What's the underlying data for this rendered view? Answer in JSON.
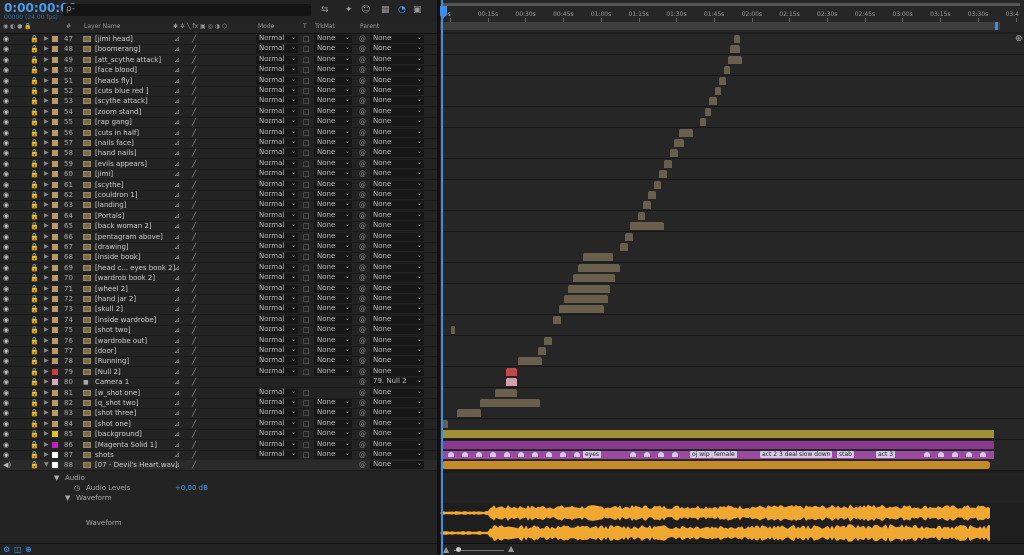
{
  "timecode": "0:00:00:00",
  "fps": "00000 (24.00 fps)",
  "search_placeholder": "ρ-",
  "columns": {
    "num": "#",
    "layer_name": "Layer Name",
    "mode": "Mode",
    "t": "T",
    "trkmat": "TrkMat",
    "parent": "Parent"
  },
  "ruler_labels": [
    "00s",
    "00:15s",
    "00:30s",
    "00:45s",
    "01:00s",
    "01:15s",
    "01:30s",
    "01:45s",
    "02:00s",
    "02:15s",
    "02:30s",
    "02:45s",
    "03:00s",
    "03:15s",
    "03:30s",
    "03:4"
  ],
  "layers": [
    {
      "num": "47",
      "name": "[jimi head]",
      "mode": "Normal",
      "trk": "None",
      "parent": "None",
      "color": "#b89968",
      "bar_start": 294,
      "bar_len": 6
    },
    {
      "num": "48",
      "name": "[boomerang]",
      "mode": "Normal",
      "trk": "None",
      "parent": "None",
      "color": "#b89968",
      "bar_start": 290,
      "bar_len": 10
    },
    {
      "num": "49",
      "name": "[att_scythe attack]",
      "mode": "Normal",
      "trk": "None",
      "parent": "None",
      "color": "#b89968",
      "bar_start": 288,
      "bar_len": 14
    },
    {
      "num": "50",
      "name": "[face blood]",
      "mode": "Normal",
      "trk": "None",
      "parent": "None",
      "color": "#b89968",
      "bar_start": 284,
      "bar_len": 6
    },
    {
      "num": "51",
      "name": "[heads fly]",
      "mode": "Normal",
      "trk": "None",
      "parent": "None",
      "color": "#b89968",
      "bar_start": 279,
      "bar_len": 7
    },
    {
      "num": "52",
      "name": "[cuts  blue red ]",
      "mode": "Normal",
      "trk": "None",
      "parent": "None",
      "color": "#b89968",
      "bar_start": 275,
      "bar_len": 6
    },
    {
      "num": "53",
      "name": "[scythe attack]",
      "mode": "Normal",
      "trk": "None",
      "parent": "None",
      "color": "#b89968",
      "bar_start": 269,
      "bar_len": 8
    },
    {
      "num": "54",
      "name": "[zoom stand]",
      "mode": "Normal",
      "trk": "None",
      "parent": "None",
      "color": "#b89968",
      "bar_start": 265,
      "bar_len": 6
    },
    {
      "num": "55",
      "name": "[rap gang]",
      "mode": "Normal",
      "trk": "None",
      "parent": "None",
      "color": "#b89968",
      "bar_start": 260,
      "bar_len": 6
    },
    {
      "num": "56",
      "name": "[cuts in half]",
      "mode": "Normal",
      "trk": "None",
      "parent": "None",
      "color": "#b89968",
      "bar_start": 239,
      "bar_len": 14
    },
    {
      "num": "57",
      "name": "[nails face]",
      "mode": "Normal",
      "trk": "None",
      "parent": "None",
      "color": "#b89968",
      "bar_start": 234,
      "bar_len": 10
    },
    {
      "num": "58",
      "name": "[hand nails]",
      "mode": "Normal",
      "trk": "None",
      "parent": "None",
      "color": "#b89968",
      "bar_start": 230,
      "bar_len": 8
    },
    {
      "num": "59",
      "name": "[evils appears]",
      "mode": "Normal",
      "trk": "None",
      "parent": "None",
      "color": "#b89968",
      "bar_start": 224,
      "bar_len": 8
    },
    {
      "num": "60",
      "name": "[jimi]",
      "mode": "Normal",
      "trk": "None",
      "parent": "None",
      "color": "#b89968",
      "bar_start": 219,
      "bar_len": 8
    },
    {
      "num": "61",
      "name": "[scythe]",
      "mode": "Normal",
      "trk": "None",
      "parent": "None",
      "color": "#b89968",
      "bar_start": 214,
      "bar_len": 7
    },
    {
      "num": "62",
      "name": "[couldron 1]",
      "mode": "Normal",
      "trk": "None",
      "parent": "None",
      "color": "#b89968",
      "bar_start": 208,
      "bar_len": 8
    },
    {
      "num": "63",
      "name": "[landing]",
      "mode": "Normal",
      "trk": "None",
      "parent": "None",
      "color": "#b89968",
      "bar_start": 203,
      "bar_len": 8
    },
    {
      "num": "64",
      "name": "[Portals]",
      "mode": "Normal",
      "trk": "None",
      "parent": "None",
      "color": "#b89968",
      "bar_start": 198,
      "bar_len": 7
    },
    {
      "num": "65",
      "name": "[back woman 2]",
      "mode": "Normal",
      "trk": "None",
      "parent": "None",
      "color": "#b89968",
      "bar_start": 190,
      "bar_len": 34
    },
    {
      "num": "66",
      "name": "[pentagram above]",
      "mode": "Normal",
      "trk": "None",
      "parent": "None",
      "color": "#b89968",
      "bar_start": 185,
      "bar_len": 8
    },
    {
      "num": "67",
      "name": "[drawing]",
      "mode": "Normal",
      "trk": "None",
      "parent": "None",
      "color": "#b89968",
      "bar_start": 180,
      "bar_len": 8
    },
    {
      "num": "68",
      "name": "[inside book]",
      "mode": "Normal",
      "trk": "None",
      "parent": "None",
      "color": "#b89968",
      "bar_start": 143,
      "bar_len": 30
    },
    {
      "num": "69",
      "name": "[head c... eyes book 2]",
      "mode": "Normal",
      "trk": "None",
      "parent": "None",
      "color": "#b89968",
      "bar_start": 138,
      "bar_len": 42
    },
    {
      "num": "70",
      "name": "[wardrob book 2]",
      "mode": "Normal",
      "trk": "None",
      "parent": "None",
      "color": "#b89968",
      "bar_start": 133,
      "bar_len": 42
    },
    {
      "num": "71",
      "name": "[wheel 2]",
      "mode": "Normal",
      "trk": "None",
      "parent": "None",
      "color": "#b89968",
      "bar_start": 128,
      "bar_len": 42
    },
    {
      "num": "72",
      "name": "[hand jar 2]",
      "mode": "Normal",
      "trk": "None",
      "parent": "None",
      "color": "#b89968",
      "bar_start": 124,
      "bar_len": 44
    },
    {
      "num": "73",
      "name": "[skull 2]",
      "mode": "Normal",
      "trk": "None",
      "parent": "None",
      "color": "#b89968",
      "bar_start": 119,
      "bar_len": 45
    },
    {
      "num": "74",
      "name": "[inside wardrobe]",
      "mode": "Normal",
      "trk": "None",
      "parent": "None",
      "color": "#b89968",
      "bar_start": 113,
      "bar_len": 8
    },
    {
      "num": "75",
      "name": "[shot two]",
      "mode": "Normal",
      "trk": "None",
      "parent": "None",
      "color": "#b89968",
      "bar_start": 11,
      "bar_len": 4
    },
    {
      "num": "76",
      "name": "[wardrobe out]",
      "mode": "Normal",
      "trk": "None",
      "parent": "None",
      "color": "#b89968",
      "bar_start": 104,
      "bar_len": 8
    },
    {
      "num": "77",
      "name": "[door]",
      "mode": "Normal",
      "trk": "None",
      "parent": "None",
      "color": "#b89968",
      "bar_start": 98,
      "bar_len": 8
    },
    {
      "num": "78",
      "name": "[Running]",
      "mode": "Normal",
      "trk": "None",
      "parent": "None",
      "color": "#b89968",
      "bar_start": 78,
      "bar_len": 24
    },
    {
      "num": "79",
      "name": "[Null 2]",
      "mode": "Normal",
      "trk": "None",
      "parent": "None",
      "color": "#c84040",
      "bar_start": 66,
      "bar_len": 11
    },
    {
      "num": "80",
      "name": "Camera 1",
      "mode": "",
      "trk": "",
      "parent": "79. Null 2",
      "color": "#d6a8b8",
      "bar_start": 66,
      "bar_len": 11
    },
    {
      "num": "81",
      "name": "[w_shot one]",
      "mode": "Normal",
      "trk": "",
      "parent": "None",
      "color": "#b89968",
      "bar_start": 55,
      "bar_len": 22
    },
    {
      "num": "82",
      "name": "[q_shot two]",
      "mode": "Normal",
      "trk": "None",
      "parent": "None",
      "color": "#b89968",
      "bar_start": 40,
      "bar_len": 60
    },
    {
      "num": "83",
      "name": "[shot three]",
      "mode": "Normal",
      "trk": "None",
      "parent": "None",
      "color": "#b89968",
      "bar_start": 17,
      "bar_len": 24
    },
    {
      "num": "84",
      "name": "[shot one]",
      "mode": "Normal",
      "trk": "None",
      "parent": "None",
      "color": "#b89968",
      "bar_start": 2,
      "bar_len": 6
    },
    {
      "num": "85",
      "name": "[background]",
      "mode": "Normal",
      "trk": "None",
      "parent": "None",
      "color": "#e0c020",
      "bar_start": 2,
      "bar_len": 552
    },
    {
      "num": "86",
      "name": "[Magenta Solid 1]",
      "mode": "Normal",
      "trk": "None",
      "parent": "None",
      "color": "#c020c0",
      "bar_start": 2,
      "bar_len": 552
    },
    {
      "num": "87",
      "name": "shots",
      "mode": "Normal",
      "trk": "None",
      "parent": "None",
      "color": "#ffffff",
      "bar_start": 2,
      "bar_len": 552
    },
    {
      "num": "88",
      "name": "[07 - Devil's Heart.wav]",
      "mode": "",
      "trk": "",
      "parent": "None",
      "color": "#ffffff",
      "bar_start": 2,
      "bar_len": 548
    }
  ],
  "markers": [
    "eyes",
    "oj wip",
    "female",
    "act 2 3 deal",
    "slow down",
    "stab",
    "act 3"
  ],
  "audio": {
    "label": "Audio",
    "levels_label": "Audio Levels",
    "levels_value": "+0,00 dB",
    "waveform_label": "Waveform",
    "waveform_label2": "Waveform"
  },
  "colors": {
    "accent": "#3d8ee6",
    "audio": "#f0a830",
    "bar": "#6a5f4c",
    "background_bar": "#a09038",
    "magenta_bar": "#8a3a8e",
    "shots_bar": "#9a4aa0",
    "audio_bar": "#c58a2a"
  }
}
